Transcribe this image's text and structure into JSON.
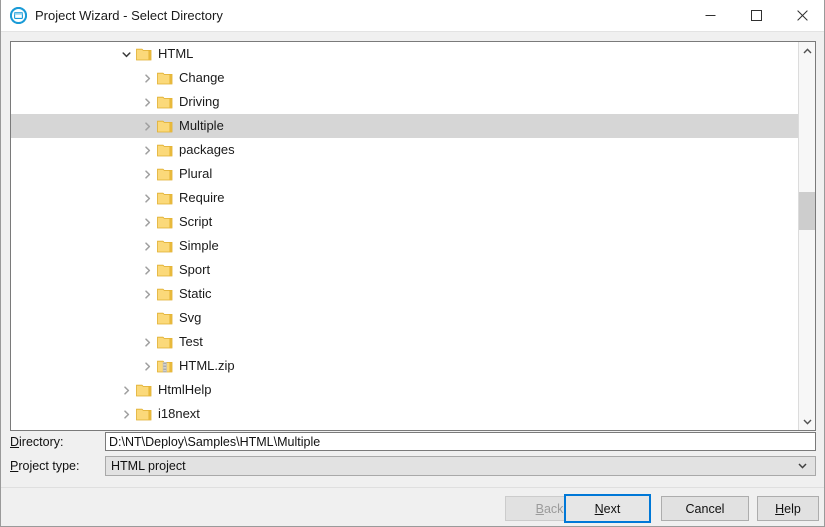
{
  "window": {
    "title": "Project Wizard - Select Directory",
    "icon": "app-circle-icon",
    "controls": {
      "minimize": "minimize-icon",
      "maximize": "maximize-icon",
      "close": "close-icon"
    }
  },
  "colors": {
    "titlebar_bg": "#ffffff",
    "dialog_bg": "#f0f0f0",
    "tree_bg": "#ffffff",
    "selection_bg": "#d6d6d6",
    "folder_yellow": "#fbd97a",
    "accent_blue": "#0078d7",
    "icon_blue": "#1a9bd7"
  },
  "tree": {
    "rows": [
      {
        "label": "HTML",
        "depth": 0,
        "expander": "down",
        "icon": "folder-icon",
        "selected": false
      },
      {
        "label": "Change",
        "depth": 1,
        "expander": "right",
        "icon": "folder-icon",
        "selected": false
      },
      {
        "label": "Driving",
        "depth": 1,
        "expander": "right",
        "icon": "folder-icon",
        "selected": false
      },
      {
        "label": "Multiple",
        "depth": 1,
        "expander": "right",
        "icon": "folder-icon",
        "selected": true
      },
      {
        "label": "packages",
        "depth": 1,
        "expander": "right",
        "icon": "folder-icon",
        "selected": false
      },
      {
        "label": "Plural",
        "depth": 1,
        "expander": "right",
        "icon": "folder-icon",
        "selected": false
      },
      {
        "label": "Require",
        "depth": 1,
        "expander": "right",
        "icon": "folder-icon",
        "selected": false
      },
      {
        "label": "Script",
        "depth": 1,
        "expander": "right",
        "icon": "folder-icon",
        "selected": false
      },
      {
        "label": "Simple",
        "depth": 1,
        "expander": "right",
        "icon": "folder-icon",
        "selected": false
      },
      {
        "label": "Sport",
        "depth": 1,
        "expander": "right",
        "icon": "folder-icon",
        "selected": false
      },
      {
        "label": "Static",
        "depth": 1,
        "expander": "right",
        "icon": "folder-icon",
        "selected": false
      },
      {
        "label": "Svg",
        "depth": 1,
        "expander": "none",
        "icon": "folder-icon",
        "selected": false
      },
      {
        "label": "Test",
        "depth": 1,
        "expander": "right",
        "icon": "folder-icon",
        "selected": false
      },
      {
        "label": "HTML.zip",
        "depth": 1,
        "expander": "right",
        "icon": "zip-folder-icon",
        "selected": false
      },
      {
        "label": "HtmlHelp",
        "depth": 0,
        "expander": "right",
        "icon": "folder-icon",
        "selected": false
      },
      {
        "label": "i18next",
        "depth": 0,
        "expander": "right",
        "icon": "folder-icon",
        "selected": false
      }
    ],
    "scrollbar": {
      "up_arrow": "chevron-up-icon",
      "down_arrow": "chevron-down-icon"
    }
  },
  "fields": {
    "directory": {
      "label_before": "",
      "label_mnemonic": "D",
      "label_after": "irectory:",
      "value": "D:\\NT\\Deploy\\Samples\\HTML\\Multiple",
      "placeholder": ""
    },
    "project_type": {
      "label_before": "",
      "label_mnemonic": "P",
      "label_after": "roject type:",
      "value": "HTML project",
      "arrow": "chevron-down-icon"
    }
  },
  "buttons": {
    "back": {
      "before": "",
      "mnemonic": "B",
      "after": "ack",
      "state": "disabled"
    },
    "next": {
      "before": "",
      "mnemonic": "N",
      "after": "ext",
      "state": "default"
    },
    "cancel": {
      "before": "Cancel",
      "mnemonic": "",
      "after": "",
      "state": "normal"
    },
    "help": {
      "before": "",
      "mnemonic": "H",
      "after": "elp",
      "state": "normal"
    }
  },
  "clipped_bottom_text": ""
}
